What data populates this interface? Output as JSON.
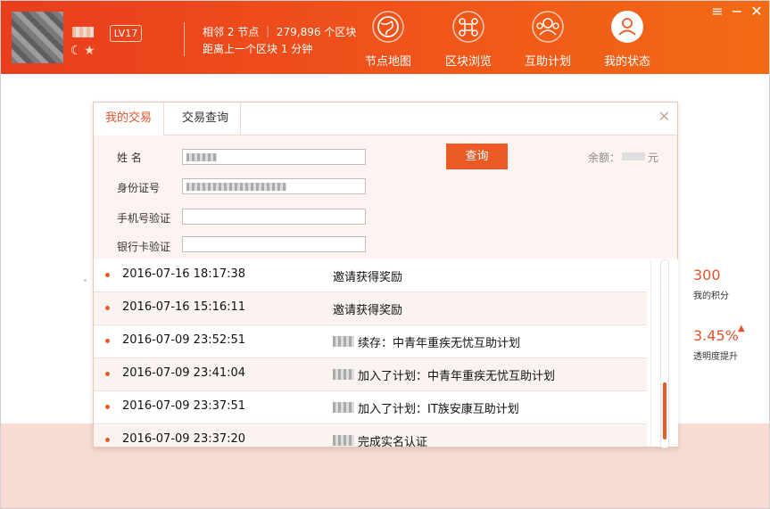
{
  "header": {
    "level": "LV17",
    "network_line1": "相邻 2 节点 ｜ 279,896 个区块",
    "network_line2": "距离上一个区块 1 分钟"
  },
  "nav": [
    {
      "label": "节点地图",
      "icon": "globe-icon"
    },
    {
      "label": "区块浏览",
      "icon": "block-browse-icon"
    },
    {
      "label": "互助计划",
      "icon": "mutual-aid-icon"
    },
    {
      "label": "我的状态",
      "icon": "user-status-icon"
    }
  ],
  "window_controls": {
    "menu": "≡",
    "minimize": "−",
    "close": "✕"
  },
  "dialog": {
    "tabs": [
      "我的交易",
      "交易查询"
    ],
    "form": {
      "name_label": "姓    名",
      "id_label": "身份证号",
      "phone_label": "手机号验证",
      "bank_label": "银行卡验证",
      "query_button": "查询",
      "balance_label": "余额：",
      "balance_unit": "元"
    },
    "transactions": [
      {
        "time": "2016-07-16 18:17:38",
        "desc": "邀请获得奖励",
        "has_user": false
      },
      {
        "time": "2016-07-16 15:16:11",
        "desc": "邀请获得奖励",
        "has_user": false
      },
      {
        "time": "2016-07-09 23:52:51",
        "desc": "续存：中青年重疾无忧互助计划",
        "has_user": true
      },
      {
        "time": "2016-07-09 23:41:04",
        "desc": "加入了计划：中青年重疾无忧互助计划",
        "has_user": true
      },
      {
        "time": "2016-07-09 23:37:51",
        "desc": "加入了计划：IT族安康互助计划",
        "has_user": true
      },
      {
        "time": "2016-07-09 23:37:20",
        "desc": "完成实名认证",
        "has_user": true
      }
    ]
  },
  "side_stats": {
    "points_value": "300",
    "points_label": "我的积分",
    "transparency_value": "3.45%",
    "transparency_label": "透明度提升"
  },
  "colors": {
    "accent": "#ec5b26",
    "header_start": "#e93d1e",
    "header_end": "#f26a14"
  }
}
